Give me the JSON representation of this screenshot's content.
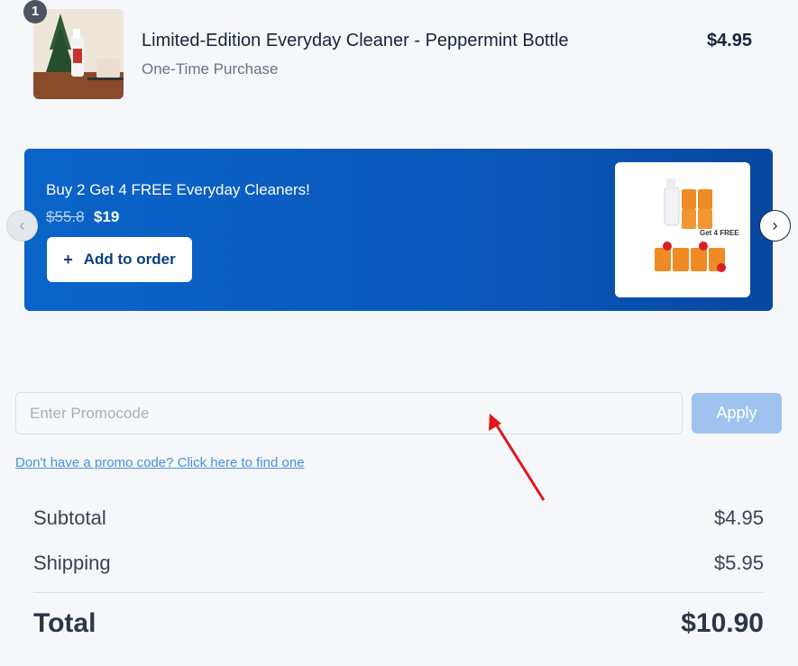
{
  "cart_item": {
    "quantity": "1",
    "title": "Limited-Edition Everyday Cleaner - Peppermint Bottle",
    "subtitle": "One-Time Purchase",
    "price": "$4.95"
  },
  "upsell": {
    "title": "Buy 2 Get 4 FREE Everyday Cleaners!",
    "old_price": "$55.8",
    "new_price": "$19",
    "button_label": "Add to order",
    "button_icon": "plus-icon",
    "image_caption": "Get 4 FREE",
    "prev_icon": "chevron-left-icon",
    "next_icon": "chevron-right-icon"
  },
  "promo": {
    "placeholder": "Enter Promocode",
    "value": "",
    "apply_label": "Apply",
    "help_link": "Don't have a promo code? Click here to find one"
  },
  "summary": {
    "subtotal_label": "Subtotal",
    "subtotal_value": "$4.95",
    "shipping_label": "Shipping",
    "shipping_value": "$5.95",
    "total_label": "Total",
    "total_value": "$10.90"
  },
  "colors": {
    "brand_blue": "#0a64c9",
    "apply_disabled": "#9fc3ee",
    "annotation_arrow": "#e0161b"
  }
}
